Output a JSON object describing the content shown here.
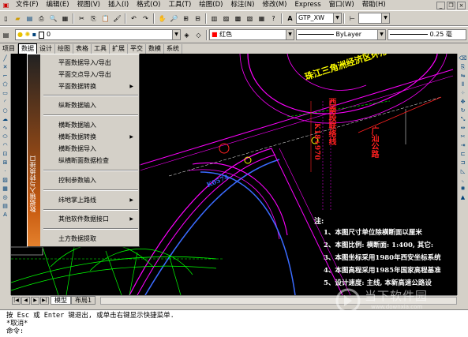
{
  "menubar": {
    "items": [
      "文件(F)",
      "编辑(E)",
      "视图(V)",
      "插入(I)",
      "格式(O)",
      "工具(T)",
      "绘图(D)",
      "标注(N)",
      "修改(M)",
      "Express",
      "窗口(W)",
      "帮助(H)"
    ]
  },
  "toolbar2": {
    "layer_value": "0",
    "color_value": "红色",
    "linetype_value": "ByLayer",
    "lineweight_value": "0.25 毫"
  },
  "toolbar1": {
    "textstyle_value": "GTP_XW"
  },
  "tabs": [
    "项目",
    "数据",
    "设计",
    "绘图",
    "表格",
    "工具",
    "扩展",
    "平交",
    "数模",
    "系统"
  ],
  "menu": {
    "band_label": "数据输入与转换接口",
    "items": [
      {
        "label": "平面数据导入/导出",
        "submenu": false
      },
      {
        "label": "平面交点导入/导出",
        "submenu": false
      },
      {
        "label": "平面数据转换",
        "submenu": true
      },
      {
        "label": "纵断数据输入",
        "submenu": false
      },
      {
        "label": "横断数据输入",
        "submenu": false
      },
      {
        "label": "横断数据转换",
        "submenu": true
      },
      {
        "label": "横断数据导入",
        "submenu": false
      },
      {
        "label": "纵横断面数据检查",
        "submenu": false
      },
      {
        "label": "控制参数输入",
        "submenu": false
      },
      {
        "label": "纬地掌上路线",
        "submenu": true
      },
      {
        "label": "其他软件数据接口",
        "submenu": true
      },
      {
        "label": "土方数据提取",
        "submenu": false
      }
    ]
  },
  "drawing": {
    "title_text": "珠江三角洲经济区环形公路特功",
    "notes_heading": "注:",
    "notes": [
      "1、本图尺寸单位除横断面以厘米",
      "2、本图比例: 横断面: 1:400, 其它:",
      "3、本图坐标采用1980年西安坐标系统",
      "4、本图高程采用1985年国家高程基准",
      "5、设计速度: 主线, 本新高速公路设"
    ],
    "label_a": "西南段联络线",
    "label_b": "K18+970",
    "label_c": "广汕公路",
    "label_d": "K0574"
  },
  "layout_tabs": {
    "model": "模型",
    "layout1": "布局1"
  },
  "command": {
    "line1": "按 Esc 或 Enter 键退出, 或单击右键显示快捷菜单.",
    "line2": "*取消*",
    "line3": "命令:"
  },
  "watermark": {
    "text": "当下软件园",
    "url": "www.downxia.com"
  },
  "colors": {
    "menu_band_top": "#222222",
    "menu_band_bottom": "#e4812d",
    "road_magenta": "#ff00ff",
    "road_green": "#00ff00",
    "road_blue": "#3a6bff",
    "annot_yellow": "#ffff00",
    "annot_red": "#ff2020"
  }
}
